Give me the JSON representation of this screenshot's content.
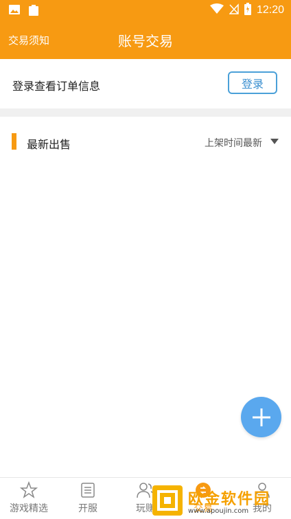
{
  "status_bar": {
    "time": "12:20",
    "icons": [
      "image-icon",
      "clipboard-icon",
      "wifi-icon",
      "signal-off-icon",
      "battery-icon"
    ]
  },
  "header": {
    "left_link": "交易须知",
    "title": "账号交易"
  },
  "login": {
    "prompt": "登录查看订单信息",
    "button": "登录"
  },
  "section": {
    "title": "最新出售",
    "sort_label": "上架时间最新"
  },
  "bottom_nav": {
    "items": [
      {
        "label": "游戏精选",
        "icon": "star-icon"
      },
      {
        "label": "开服",
        "icon": "list-icon"
      },
      {
        "label": "玩赚",
        "icon": "users-icon"
      },
      {
        "label": "交易",
        "icon": "trade-icon"
      },
      {
        "label": "我的",
        "icon": "person-icon"
      }
    ]
  },
  "watermark": {
    "text": "欧金软件园",
    "url": "www.apoujin.com"
  },
  "colors": {
    "brand": "#f79a12",
    "accent_blue": "#4aa0d8",
    "fab": "#5aa8ee"
  }
}
